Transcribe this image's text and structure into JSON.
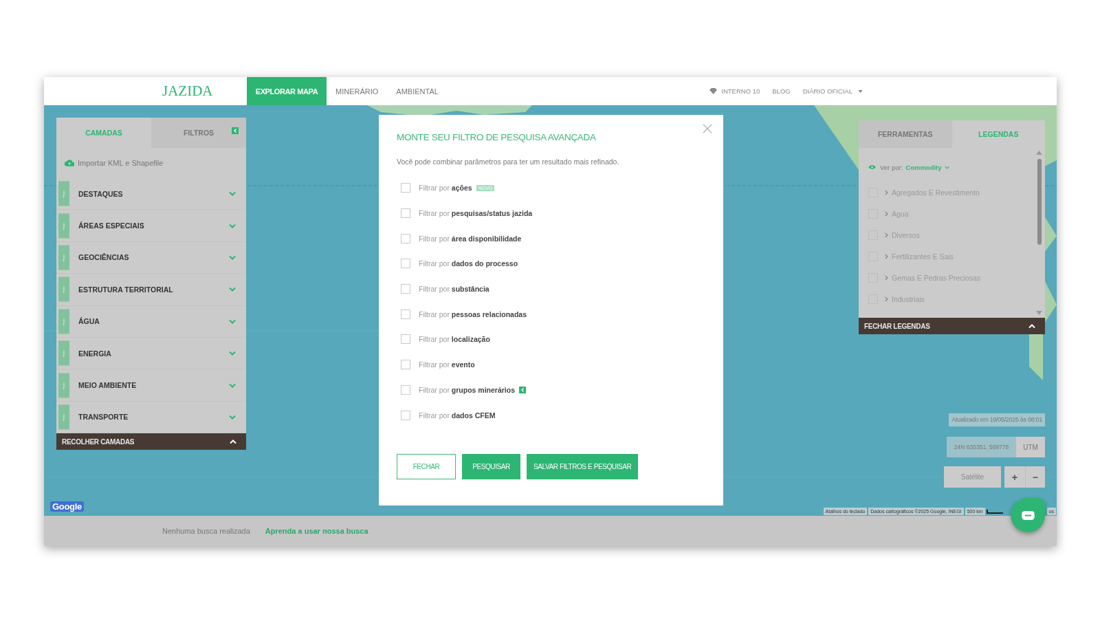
{
  "header": {
    "logo": "JAZIDA",
    "nav": [
      {
        "label": "EXPLORAR MAPA",
        "selected": true
      },
      {
        "label": "MINERÁRIO",
        "selected": false
      },
      {
        "label": "AMBIENTAL",
        "selected": false
      }
    ],
    "links": [
      {
        "kind": "plan",
        "label": "INTERNO 10"
      },
      {
        "kind": "link",
        "label": "BLOG"
      },
      {
        "kind": "dropdown",
        "label": "DIÁRIO OFICIAL"
      }
    ]
  },
  "layers_panel": {
    "tabs": [
      {
        "label": "CAMADAS",
        "selected": true,
        "kind": "text"
      },
      {
        "label": "FILTROS",
        "selected": false,
        "kind": "icon"
      }
    ],
    "import_link": "Importar KML e Shapefile",
    "sections": [
      {
        "label": "DESTAQUES",
        "expanded": false
      },
      {
        "label": "ÁREAS ESPECIAIS",
        "expanded": false
      },
      {
        "label": "GEOCIÊNCIAS",
        "expanded": false
      },
      {
        "label": "ESTRUTURA TERRITORIAL",
        "expanded": false
      },
      {
        "label": "ÁGUA",
        "expanded": false
      },
      {
        "label": "ENERGIA",
        "expanded": false
      },
      {
        "label": "MEIO AMBIENTE",
        "expanded": false
      },
      {
        "label": "TRANSPORTE",
        "expanded": false
      }
    ],
    "collapse_bar": "RECOLHER CAMADAS"
  },
  "dialog": {
    "title": "MONTE SEU FILTRO DE PESQUISA AVANÇADA",
    "description": "Você pode combinar parâmetros para ter um resultado mais refinado.",
    "filters": [
      {
        "label": "Filtrar por **ações**",
        "checked": false,
        "kind": "new",
        "badge": "NOVO"
      },
      {
        "label": "Filtrar por **pesquisas/status jazida**",
        "checked": false,
        "kind": "plain"
      },
      {
        "label": "Filtrar por **área disponibilidade**",
        "checked": false,
        "kind": "plain"
      },
      {
        "label": "Filtrar por **dados do processo**",
        "checked": false,
        "kind": "plain"
      },
      {
        "label": "Filtrar por **substância**",
        "checked": false,
        "kind": "plain"
      },
      {
        "label": "Filtrar por **pessoas relacionadas**",
        "checked": false,
        "kind": "plain"
      },
      {
        "label": "Filtrar por **localização**",
        "checked": false,
        "kind": "plain"
      },
      {
        "label": "Filtrar por **evento**",
        "checked": false,
        "kind": "plain"
      },
      {
        "label": "Filtrar por **grupos minerários**",
        "checked": false,
        "kind": "icon"
      },
      {
        "label": "Filtrar por **dados CFEM**",
        "checked": false,
        "kind": "plain"
      }
    ],
    "buttons": [
      {
        "label": "FECHAR",
        "kind": "outline"
      },
      {
        "label": "PESQUISAR",
        "kind": "primary"
      },
      {
        "label": "SALVAR FILTROS E PESQUISAR",
        "kind": "primary"
      }
    ]
  },
  "legend_panel": {
    "tabs": [
      {
        "label": "FERRAMENTAS",
        "selected": false
      },
      {
        "label": "LEGENDAS",
        "selected": true
      }
    ],
    "view_by": {
      "label": "Ver por:",
      "value": "Commodity"
    },
    "items": [
      {
        "label": "Agregados E Revestimento",
        "checked": false
      },
      {
        "label": "Agua",
        "checked": false
      },
      {
        "label": "Diversos",
        "checked": false
      },
      {
        "label": "Fertilizantes E Sais",
        "checked": false
      },
      {
        "label": "Gemas E Pedras Preciosas",
        "checked": false
      },
      {
        "label": "Industriais",
        "checked": false
      }
    ],
    "collapse_bar": "FECHAR LEGENDAS"
  },
  "map": {
    "updated": "Atualizado em 19/05/2025 às 08:01",
    "coordinates": "24N 635351, 569778",
    "coord_system": "UTM",
    "map_type_button": "Satélite",
    "zoom_in": "+",
    "zoom_out": "−",
    "logo": "Google",
    "attribution": [
      "Atalhos do teclado",
      "Dados cartográficos ©2025 Google, INEGI"
    ],
    "scale": "500 km",
    "terms": "os"
  },
  "footer": {
    "status": "Nenhuma busca realizada",
    "help_link": "Aprenda a usar nossa busca"
  }
}
